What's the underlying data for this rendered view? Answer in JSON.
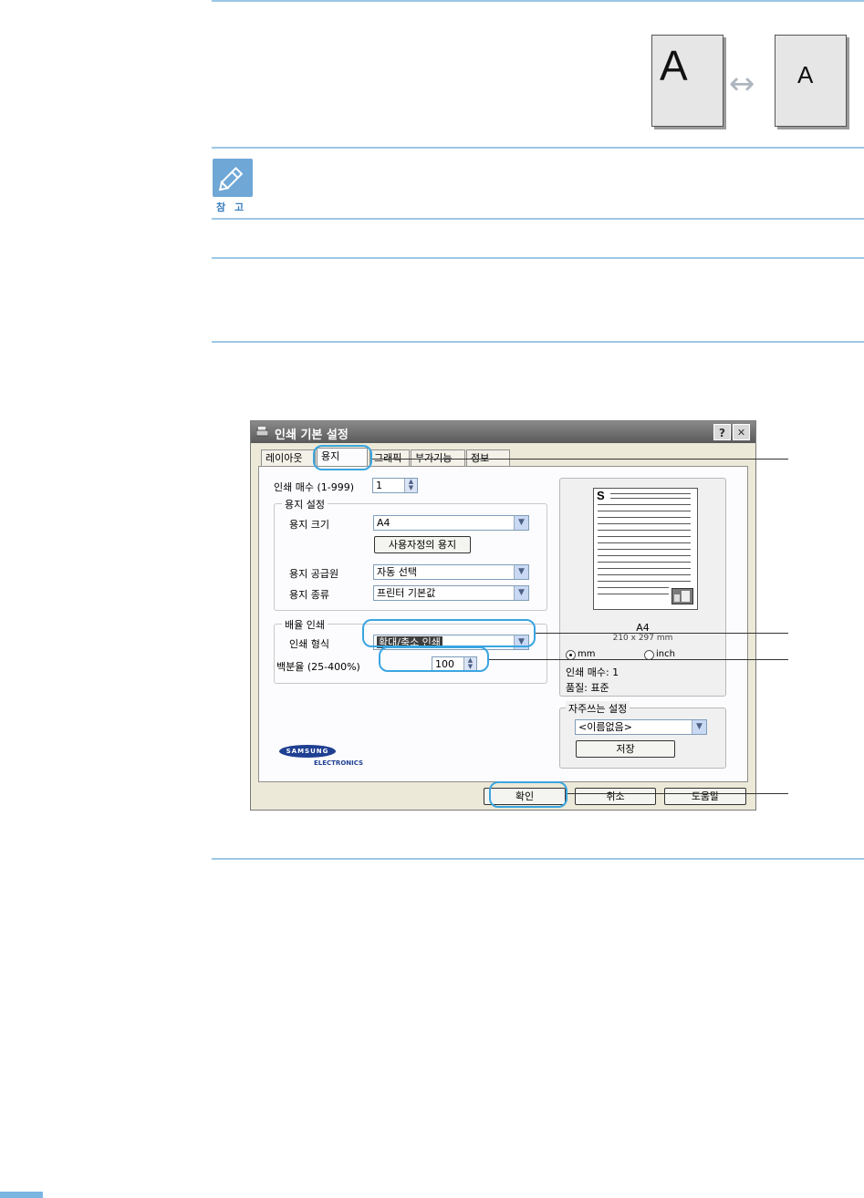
{
  "illustration": {
    "page_large_letter": "A",
    "page_small_letter": "A",
    "arrow_glyph": "↔"
  },
  "note": {
    "label": "참 고"
  },
  "dialog": {
    "title": "인쇄 기본 설정",
    "help_button": "?",
    "close_button": "✕",
    "tabs": [
      {
        "label": "레이아웃"
      },
      {
        "label": "용지"
      },
      {
        "label": "그래픽"
      },
      {
        "label": "부가기능"
      },
      {
        "label": "정보"
      }
    ],
    "copies": {
      "label": "인쇄 매수 (1-999)",
      "value": "1"
    },
    "paper_group": {
      "title": "용지 설정",
      "size_label": "용지 크기",
      "size_value": "A4",
      "custom_button": "사용자정의 용지",
      "source_label": "용지 공급원",
      "source_value": "자동 선택",
      "type_label": "용지 종류",
      "type_value": "프린터 기본값"
    },
    "scaling_group": {
      "title": "배율 인쇄",
      "type_label": "인쇄 형식",
      "type_value": "확대/축소 인쇄",
      "percent_label": "백분율 (25-400%)",
      "percent_value": "100"
    },
    "logo": {
      "brand": "SAMSUNG",
      "sub": "ELECTRONICS"
    },
    "preview": {
      "page_letter": "S",
      "paper_name": "A4",
      "paper_dims": "210 x 297 mm",
      "unit_mm": "mm",
      "unit_inch": "inch",
      "copies_text": "인쇄 매수: 1",
      "quality_text": "품질: 표준"
    },
    "favorites": {
      "title": "자주쓰는 설정",
      "value": "<이름없음>",
      "save_button": "저장"
    },
    "buttons": {
      "ok": "확인",
      "cancel": "취소",
      "help": "도움말"
    }
  }
}
